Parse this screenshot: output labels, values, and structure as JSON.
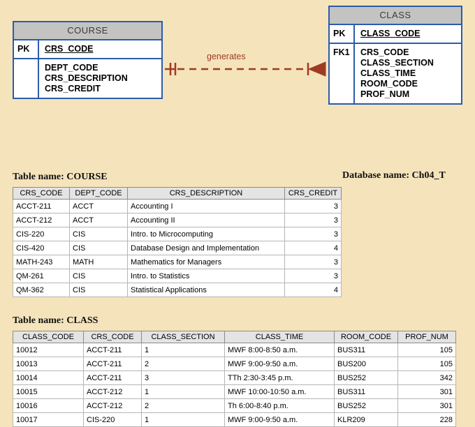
{
  "erd": {
    "entities": [
      {
        "name": "COURSE",
        "pk_tag": "PK",
        "pk_field": "CRS_CODE",
        "fk_tag": "",
        "fields": [
          "DEPT_CODE",
          "CRS_DESCRIPTION",
          "CRS_CREDIT"
        ]
      },
      {
        "name": "CLASS",
        "pk_tag": "PK",
        "pk_field": "CLASS_CODE",
        "fk_tag": "FK1",
        "fields": [
          "CRS_CODE",
          "CLASS_SECTION",
          "CLASS_TIME",
          "ROOM_CODE",
          "PROF_NUM"
        ]
      }
    ],
    "relationship": {
      "label": "generates",
      "left_cardinality": "one-and-only-one",
      "right_cardinality": "many-crows-foot",
      "line_style": "dashed",
      "color": "#9e3b23"
    }
  },
  "course_section": {
    "table_label": "Table name: COURSE",
    "database_label": "Database name: Ch04_T",
    "columns": [
      "CRS_CODE",
      "DEPT_CODE",
      "CRS_DESCRIPTION",
      "CRS_CREDIT"
    ],
    "rows": [
      [
        "ACCT-211",
        "ACCT",
        "Accounting I",
        "3"
      ],
      [
        "ACCT-212",
        "ACCT",
        "Accounting II",
        "3"
      ],
      [
        "CIS-220",
        "CIS",
        "Intro. to Microcomputing",
        "3"
      ],
      [
        "CIS-420",
        "CIS",
        "Database Design and Implementation",
        "4"
      ],
      [
        "MATH-243",
        "MATH",
        "Mathematics for Managers",
        "3"
      ],
      [
        "QM-261",
        "CIS",
        "Intro. to Statistics",
        "3"
      ],
      [
        "QM-362",
        "CIS",
        "Statistical Applications",
        "4"
      ]
    ]
  },
  "class_section": {
    "table_label": "Table name: CLASS",
    "columns": [
      "CLASS_CODE",
      "CRS_CODE",
      "CLASS_SECTION",
      "CLASS_TIME",
      "ROOM_CODE",
      "PROF_NUM"
    ],
    "rows": [
      [
        "10012",
        "ACCT-211",
        "1",
        "MWF 8:00-8:50 a.m.",
        "BUS311",
        "105"
      ],
      [
        "10013",
        "ACCT-211",
        "2",
        "MWF 9:00-9:50 a.m.",
        "BUS200",
        "105"
      ],
      [
        "10014",
        "ACCT-211",
        "3",
        "TTh 2:30-3:45 p.m.",
        "BUS252",
        "342"
      ],
      [
        "10015",
        "ACCT-212",
        "1",
        "MWF 10:00-10:50 a.m.",
        "BUS311",
        "301"
      ],
      [
        "10016",
        "ACCT-212",
        "2",
        "Th 6:00-8:40 p.m.",
        "BUS252",
        "301"
      ],
      [
        "10017",
        "CIS-220",
        "1",
        "MWF 9:00-9:50 a.m.",
        "KLR209",
        "228"
      ]
    ]
  },
  "colors": {
    "background": "#f5e3bb",
    "entity_border": "#2a5caa",
    "entity_header": "#c3c3c3",
    "relationship": "#9e3b23"
  }
}
